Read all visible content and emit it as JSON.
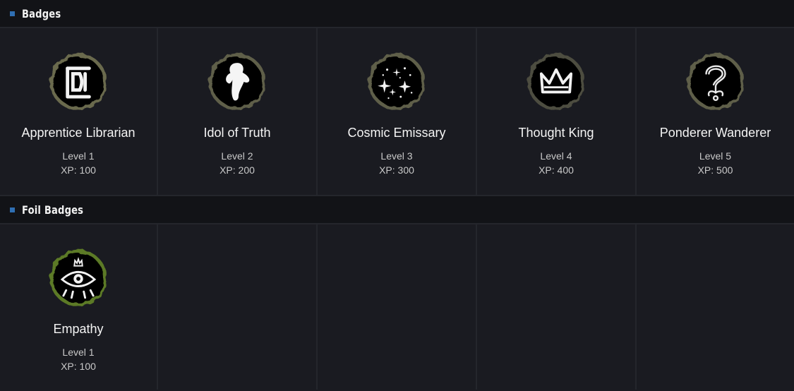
{
  "sections": {
    "badges": {
      "title": "Badges",
      "items": [
        {
          "name": "Apprentice Librarian",
          "level": "Level 1",
          "xp": "XP: 100",
          "icon": "book-glyph-icon"
        },
        {
          "name": "Idol of Truth",
          "level": "Level 2",
          "xp": "XP: 200",
          "icon": "ghost-figure-icon"
        },
        {
          "name": "Cosmic Emissary",
          "level": "Level 3",
          "xp": "XP: 300",
          "icon": "stars-icon"
        },
        {
          "name": "Thought King",
          "level": "Level 4",
          "xp": "XP: 400",
          "icon": "crown-icon"
        },
        {
          "name": "Ponderer Wanderer",
          "level": "Level 5",
          "xp": "XP: 500",
          "icon": "question-plant-icon"
        }
      ]
    },
    "foil_badges": {
      "title": "Foil Badges",
      "items": [
        {
          "name": "Empathy",
          "level": "Level 1",
          "xp": "XP: 100",
          "icon": "eye-icon"
        }
      ]
    }
  },
  "colors": {
    "background": "#1a1b21",
    "header_background": "#121317",
    "divider": "#24262c",
    "section_marker": "#2f6fb3",
    "badge_rim": "#6b6a4e",
    "foil_rim": "#6f9a2a"
  }
}
